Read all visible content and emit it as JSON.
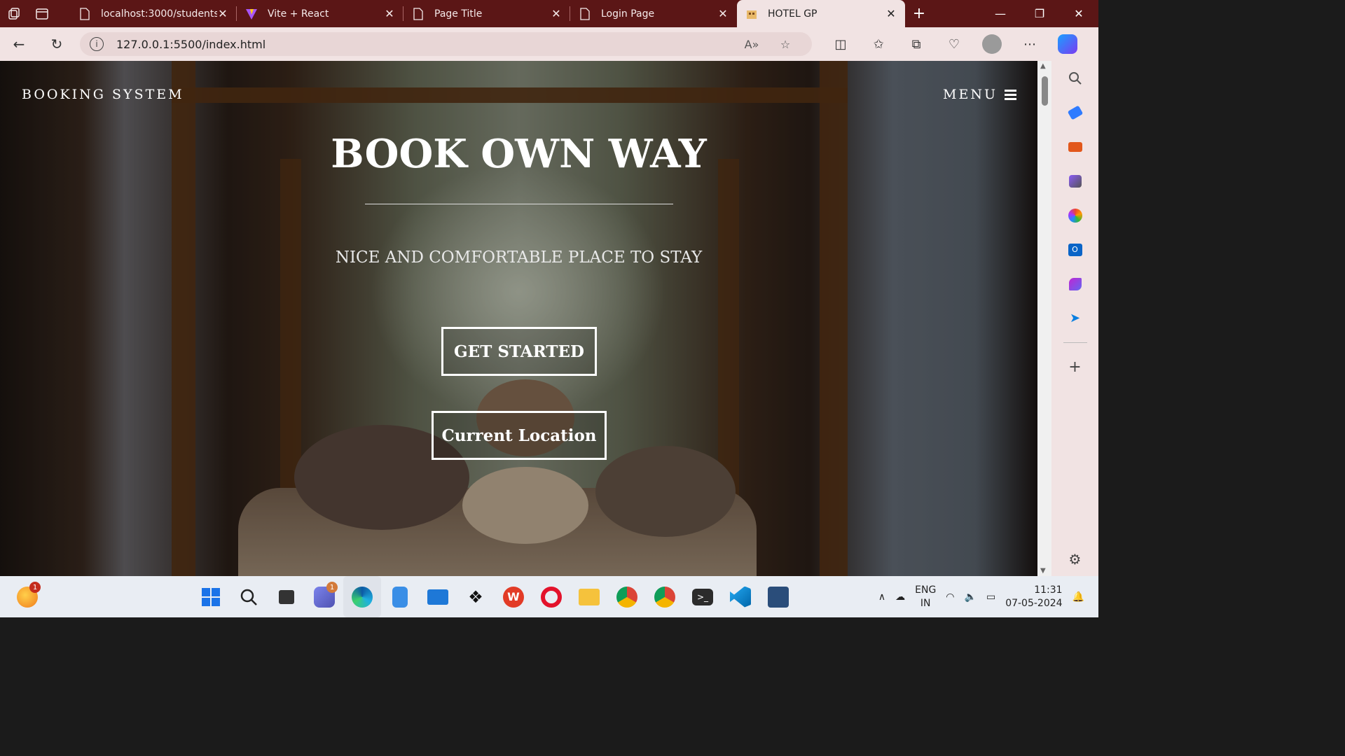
{
  "browser": {
    "tabs": [
      {
        "title": "localhost:3000/students",
        "icon": "page-icon",
        "active": false
      },
      {
        "title": "Vite + React",
        "icon": "vite-icon",
        "active": false
      },
      {
        "title": "Page Title",
        "icon": "page-icon",
        "active": false
      },
      {
        "title": "Login Page",
        "icon": "page-icon",
        "active": false
      },
      {
        "title": "HOTEL GP",
        "icon": "hotel-icon",
        "active": true
      }
    ],
    "url": "127.0.0.1:5500/index.html"
  },
  "page": {
    "brand": "BOOKING SYSTEM",
    "menu_label": "MENU",
    "hero_title": "BOOK OWN WAY",
    "hero_subtitle": "NICE AND COMFORTABLE PLACE TO STAY",
    "get_started_label": "GET STARTED",
    "current_location_label": "Current Location"
  },
  "taskbar": {
    "badges": {
      "app1": "1",
      "chat": "1"
    },
    "lang_top": "ENG",
    "lang_bottom": "IN",
    "time": "11:31",
    "date": "07-05-2024"
  },
  "colors": {
    "tabbar": "#5b1616",
    "chrome": "#f1e3e3",
    "taskbar": "#e9edf3"
  }
}
